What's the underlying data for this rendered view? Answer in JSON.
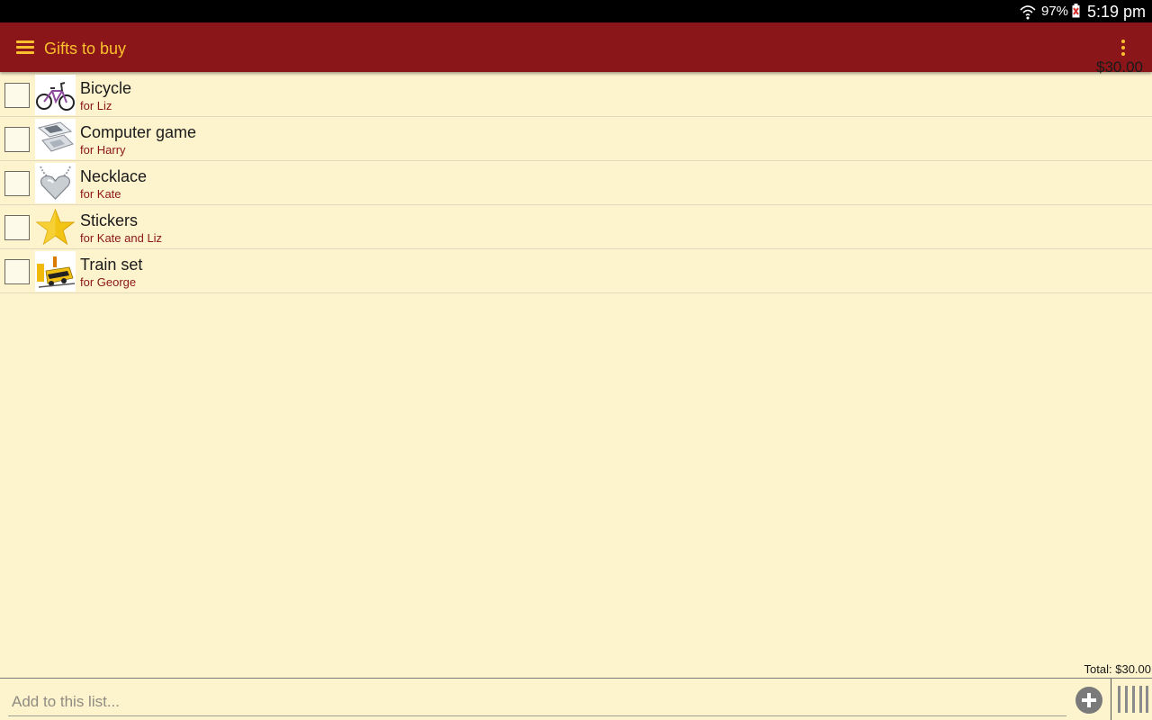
{
  "status_bar": {
    "battery_percent": "97%",
    "time": "5:19 pm"
  },
  "app_bar": {
    "title": "Gifts to buy"
  },
  "items": [
    {
      "name": "Bicycle",
      "for": "for Liz",
      "price": "",
      "checked": false,
      "icon": "bicycle-image"
    },
    {
      "name": "Computer game",
      "for": "for Harry",
      "price": "$30.00",
      "checked": false,
      "icon": "handheld-console-image"
    },
    {
      "name": "Necklace",
      "for": "for Kate",
      "price": "",
      "checked": false,
      "icon": "heart-necklace-image"
    },
    {
      "name": "Stickers",
      "for": "for Kate and Liz",
      "price": "",
      "checked": false,
      "icon": "star-sticker-image"
    },
    {
      "name": "Train set",
      "for": "for George",
      "price": "",
      "checked": false,
      "icon": "toy-train-image"
    }
  ],
  "total": "Total: $30.00",
  "add_bar": {
    "placeholder": "Add to this list..."
  },
  "colors": {
    "app_bar": "#8b1619",
    "accent": "#fbc02d",
    "background": "#fdf3cd",
    "subtitle": "#8b1619"
  }
}
